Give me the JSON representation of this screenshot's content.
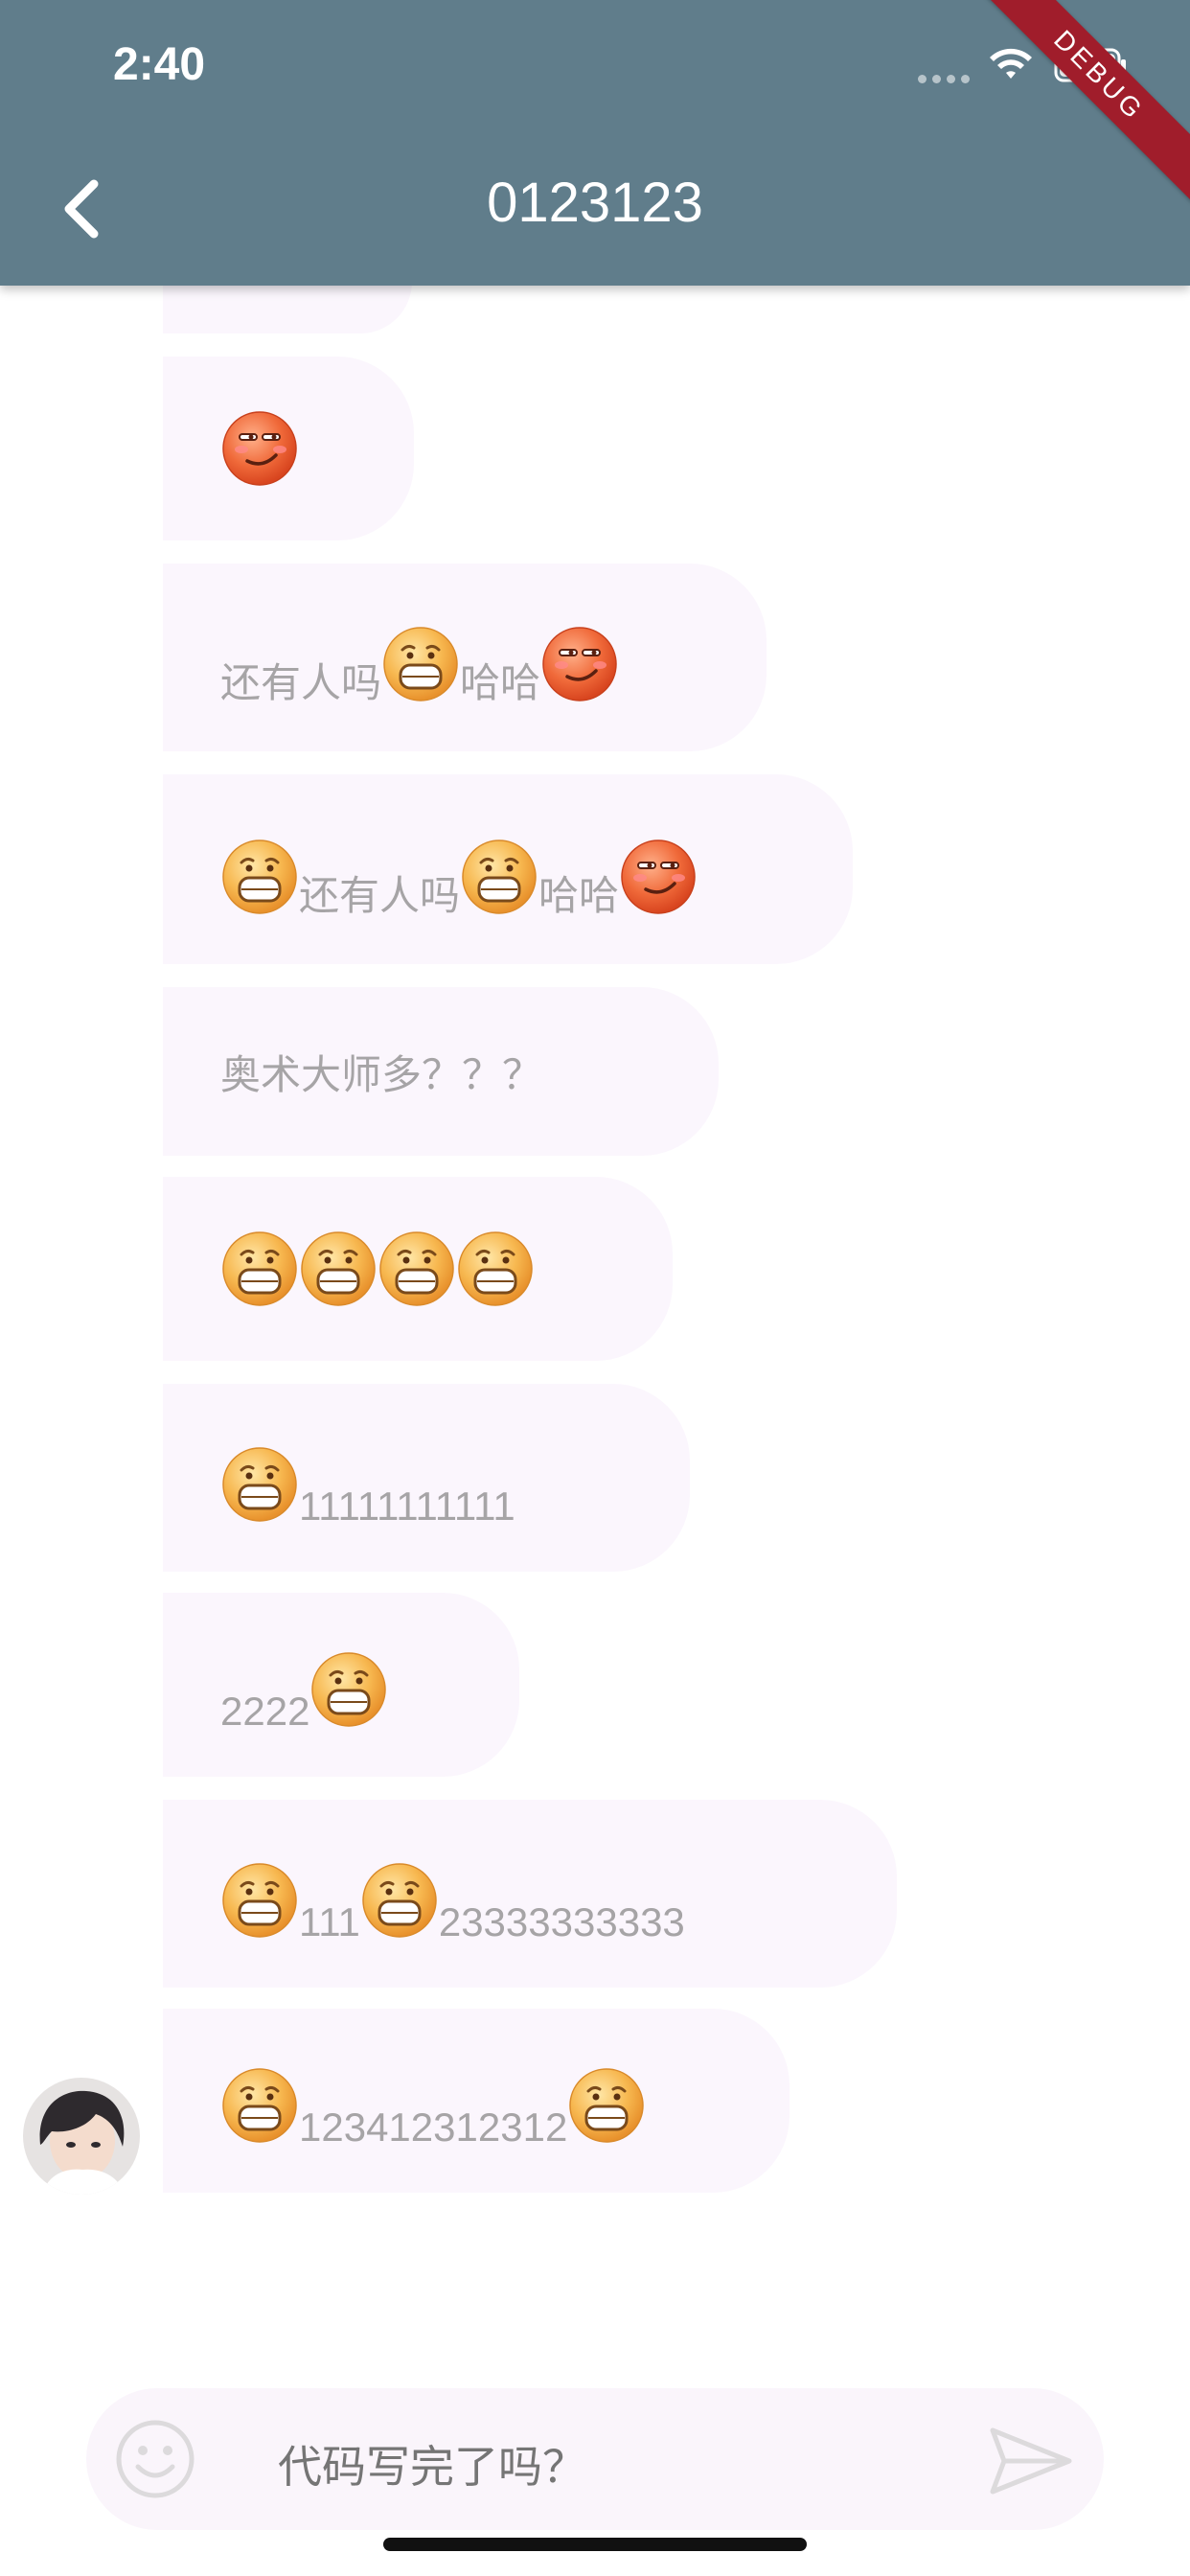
{
  "status_bar": {
    "time": "2:40"
  },
  "header": {
    "title": "0123123",
    "debug_label": "DEBUG"
  },
  "messages": [
    {
      "id": "m0",
      "parts": []
    },
    {
      "id": "m1",
      "parts": [
        {
          "emoji": "smug-face"
        }
      ]
    },
    {
      "id": "m2",
      "parts": [
        {
          "text": "还有人吗"
        },
        {
          "emoji": "grimace-face"
        },
        {
          "text": " 哈哈"
        },
        {
          "emoji": "smug-face"
        }
      ]
    },
    {
      "id": "m3",
      "parts": [
        {
          "emoji": "grimace-face"
        },
        {
          "text": "还有人吗"
        },
        {
          "emoji": "grimace-face"
        },
        {
          "text": " 哈哈"
        },
        {
          "emoji": "smug-face"
        }
      ]
    },
    {
      "id": "m4",
      "parts": [
        {
          "text": "奥术大师多？？？"
        }
      ]
    },
    {
      "id": "m5",
      "parts": [
        {
          "emoji": "grimace-face"
        },
        {
          "emoji": "grimace-face"
        },
        {
          "emoji": "grimace-face"
        },
        {
          "emoji": "grimace-face"
        }
      ]
    },
    {
      "id": "m6",
      "parts": [
        {
          "emoji": "grimace-face"
        },
        {
          "text": "11111111111"
        }
      ]
    },
    {
      "id": "m7",
      "parts": [
        {
          "text": "2222"
        },
        {
          "emoji": "grimace-face"
        }
      ]
    },
    {
      "id": "m8",
      "parts": [
        {
          "emoji": "grimace-face"
        },
        {
          "text": "111"
        },
        {
          "emoji": "grimace-face"
        },
        {
          "text": "23333333333"
        }
      ]
    },
    {
      "id": "m9",
      "parts": [
        {
          "emoji": "grimace-face"
        },
        {
          "text": "123412312312"
        },
        {
          "emoji": "grimace-face"
        }
      ]
    }
  ],
  "composer": {
    "value": "代码写完了吗？"
  },
  "colors": {
    "header_bg": "#607d8b",
    "bubble_bg": "#fbf6fd",
    "bubble_text": "#a6a4a6",
    "debug_banner": "#a01d2b"
  }
}
